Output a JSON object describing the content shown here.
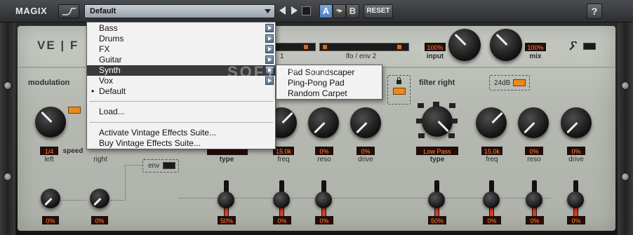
{
  "topbar": {
    "brand": "MAGIX",
    "preset_name": "Default",
    "ab_a": "A",
    "ab_copy": "•▸",
    "ab_b": "B",
    "reset": "RESET",
    "help": "?"
  },
  "plugin": {
    "logo": "VE | F",
    "lfo_label_1": "1",
    "lfo_label_2": "lfo / env 2",
    "input_value": "100%",
    "input_label": "input",
    "mix_value": "100%",
    "mix_label": "mix"
  },
  "modulation": {
    "title": "modulation",
    "speed_label": "speed",
    "left_value": "1/4",
    "left_label": "left",
    "right_label": "right",
    "env_label": "env",
    "bottom_left_value": "0%",
    "bottom_right_value": "0%"
  },
  "filter_left": {
    "type_label": "type",
    "freq_value": "15.0k",
    "freq_label": "freq",
    "reso_value": "0%",
    "reso_label": "reso",
    "drive_value": "0%",
    "drive_label": "drive",
    "fader_type_value": "50%",
    "fader_freq_value": "0%",
    "fader_reso_value": "0%"
  },
  "filter_right": {
    "title": "filter right",
    "slope": "24dB",
    "type_value": "Low Pass",
    "type_label": "type",
    "freq_value": "15.0k",
    "freq_label": "freq",
    "reso_value": "0%",
    "reso_label": "reso",
    "drive_value": "0%",
    "drive_label": "drive",
    "fader_type_value": "50%",
    "fader_freq_value": "0%",
    "fader_reso_value": "0%",
    "fader_drive_value": "0%"
  },
  "menu": {
    "items": [
      {
        "label": "Bass"
      },
      {
        "label": "Drums"
      },
      {
        "label": "FX"
      },
      {
        "label": "Guitar"
      },
      {
        "label": "Synth"
      },
      {
        "label": "Vox"
      },
      {
        "label": "Default"
      },
      {
        "label": "Load..."
      },
      {
        "label": "Activate Vintage Effects Suite..."
      },
      {
        "label": "Buy Vintage Effects Suite..."
      }
    ],
    "submenu": [
      {
        "label": "Pad Soundscaper"
      },
      {
        "label": "Ping-Pong Pad"
      },
      {
        "label": "Random Carpet"
      }
    ]
  },
  "watermark": "SOFTPEDIA",
  "colors": {
    "readout_text": "#ff8a3c",
    "accent_orange": "#e88a1e",
    "fader_fill": "#e23a1c",
    "selected_bg": "#3a3a3a"
  }
}
